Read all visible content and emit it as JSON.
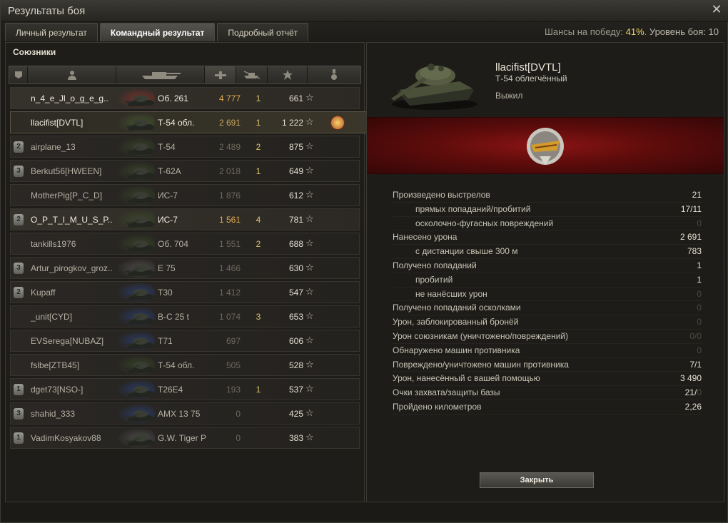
{
  "window": {
    "title": "Результаты боя"
  },
  "tabs": [
    "Личный результат",
    "Командный результат",
    "Подробный отчёт"
  ],
  "active_tab": 1,
  "odds": {
    "label": "Шансы на победу:",
    "value": "41%",
    "level_label": "Уровень боя:",
    "level": "10"
  },
  "left": {
    "title": "Союзники",
    "rows": [
      {
        "badge": "",
        "name": "n_4_e_Jl_o_g_e_g..",
        "vehicle": "Об. 261",
        "damage": "4 777",
        "frags": "1",
        "xp": "661",
        "hl": true,
        "dmg_hi": true,
        "color": "#b03030"
      },
      {
        "badge": "",
        "name": "llacifist[DVTL]",
        "vehicle": "Т-54 обл.",
        "damage": "2 691",
        "frags": "1",
        "xp": "1 222",
        "self": true,
        "medal": true,
        "color": "#4a6e33"
      },
      {
        "badge": "2",
        "name": "airplane_13",
        "vehicle": "Т-54",
        "damage": "2 489",
        "frags": "2",
        "xp": "875",
        "color": "#3f5a2a"
      },
      {
        "badge": "3",
        "name": "Berkut56[HWEEN]",
        "vehicle": "Т-62А",
        "damage": "2 018",
        "frags": "1",
        "xp": "649",
        "color": "#3f5a2a"
      },
      {
        "badge": "",
        "name": "MotherPig[P_C_D]",
        "vehicle": "ИС-7",
        "damage": "1 876",
        "frags": "",
        "xp": "612",
        "color": "#3f5a2a"
      },
      {
        "badge": "2",
        "name": "O_P_T_I_M_U_S_P..",
        "vehicle": "ИС-7",
        "damage": "1 561",
        "frags": "4",
        "xp": "781",
        "hl": true,
        "dmg_hi": true,
        "color": "#3f5a2a"
      },
      {
        "badge": "",
        "name": "tankills1976",
        "vehicle": "Об. 704",
        "damage": "1 551",
        "frags": "2",
        "xp": "688",
        "color": "#3f5a2a"
      },
      {
        "badge": "3",
        "name": "Artur_pirogkov_groz..",
        "vehicle": "E 75",
        "damage": "1 466",
        "frags": "",
        "xp": "630",
        "color": "#6b6b6b"
      },
      {
        "badge": "2",
        "name": "Kupaff",
        "vehicle": "T30",
        "damage": "1 412",
        "frags": "",
        "xp": "547",
        "color": "#2d4ea0"
      },
      {
        "badge": "",
        "name": "_unit[CYD]",
        "vehicle": "B-C 25 t",
        "damage": "1 074",
        "frags": "3",
        "xp": "653",
        "color": "#2d4ea0"
      },
      {
        "badge": "",
        "name": "EVSerega[NUBAZ]",
        "vehicle": "T71",
        "damage": "697",
        "frags": "",
        "xp": "606",
        "color": "#2d4ea0"
      },
      {
        "badge": "",
        "name": "fslbe[ZTB45]",
        "vehicle": "Т-54 обл.",
        "damage": "505",
        "frags": "",
        "xp": "528",
        "color": "#3f5a2a"
      },
      {
        "badge": "1",
        "name": "dget73[NSO-]",
        "vehicle": "T26E4",
        "damage": "193",
        "frags": "1",
        "xp": "537",
        "color": "#2d4ea0"
      },
      {
        "badge": "3",
        "name": "shahid_333",
        "vehicle": "AMX 13 75",
        "damage": "0",
        "frags": "",
        "xp": "425",
        "color": "#2d4ea0"
      },
      {
        "badge": "1",
        "name": "VadimKosyakov88",
        "vehicle": "G.W. Tiger P",
        "damage": "0",
        "frags": "",
        "xp": "383",
        "color": "#6b6b6b"
      }
    ]
  },
  "right": {
    "player": "llacifist[DVTL]",
    "tank": "Т-54 облегчённый",
    "status": "Выжил",
    "stats": [
      {
        "label": "Произведено выстрелов",
        "value": "21",
        "sub": false
      },
      {
        "label": "прямых попаданий/пробитий",
        "value": "17/11",
        "sub": true
      },
      {
        "label": "осколочно-фугасных повреждений",
        "value": "0",
        "sub": true,
        "dim": true
      },
      {
        "label": "Нанесено урона",
        "value": "2 691",
        "sub": false
      },
      {
        "label": "с дистанции свыше 300 м",
        "value": "783",
        "sub": true
      },
      {
        "label": "Получено попаданий",
        "value": "1",
        "sub": false
      },
      {
        "label": "пробитий",
        "value": "1",
        "sub": true
      },
      {
        "label": "не нанёсших урон",
        "value": "0",
        "sub": true,
        "dim": true
      },
      {
        "label": "Получено попаданий осколками",
        "value": "0",
        "sub": false,
        "dim": true
      },
      {
        "label": "Урон, заблокированный бронёй",
        "value": "0",
        "sub": false,
        "dim": true
      },
      {
        "label": "Урон союзникам (уничтожено/повреждений)",
        "value": "0/0",
        "sub": false,
        "dim": true
      },
      {
        "label": "Обнаружено машин противника",
        "value": "0",
        "sub": false,
        "dim": true
      },
      {
        "label": "Повреждено/уничтожено машин противника",
        "value": "7/1",
        "sub": false
      },
      {
        "label": "Урон, нанесённый с вашей помощью",
        "value": "3 490",
        "sub": false
      },
      {
        "label": "Очки захвата/защиты базы",
        "value": "21/",
        "value_dim": "0",
        "sub": false
      },
      {
        "label": "Пройдено километров",
        "value": "2,26",
        "sub": false
      }
    ],
    "close_label": "Закрыть"
  }
}
